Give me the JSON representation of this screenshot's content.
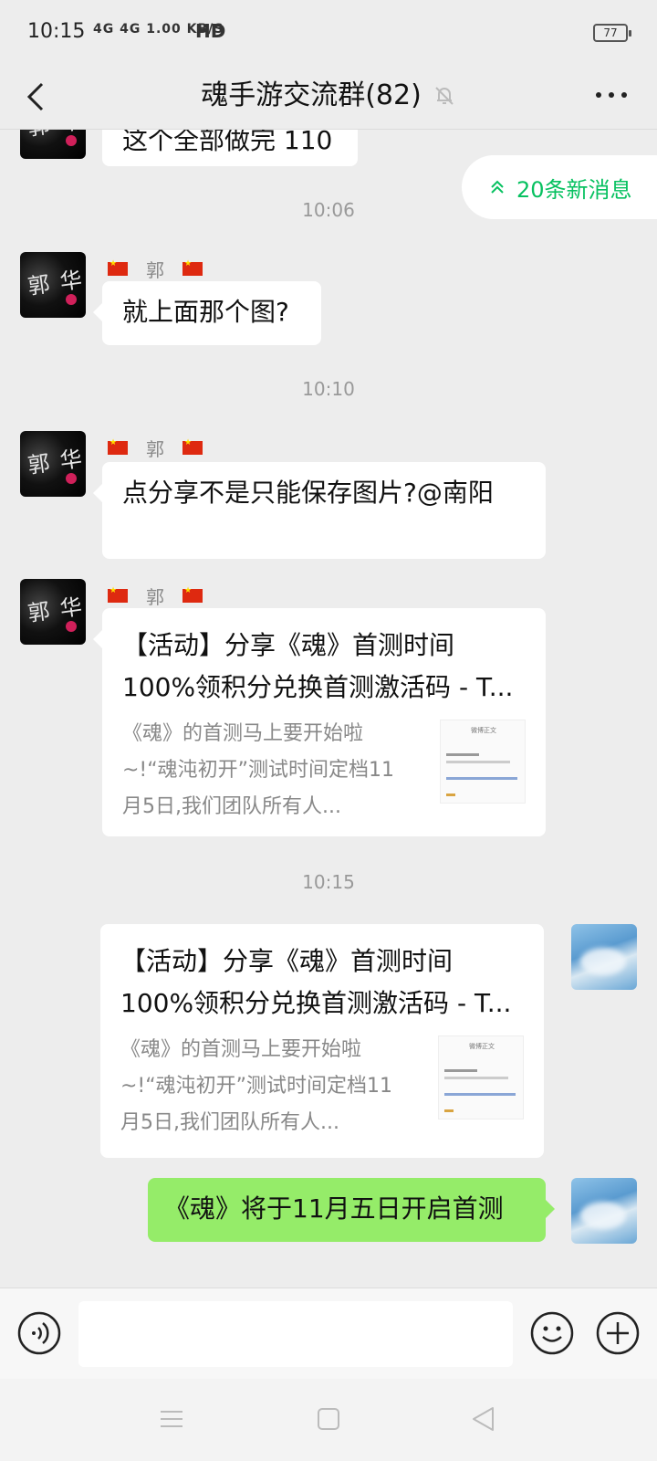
{
  "status_bar": {
    "time": "10:15",
    "signal": "4G 4G 1.00 KB/S",
    "hd": "HD",
    "battery": "77"
  },
  "header": {
    "title": "魂手游交流群(82)"
  },
  "new_messages_pill": {
    "label": "20条新消息"
  },
  "messages": [
    {
      "text": "这个全部做完 110"
    },
    {
      "timestamp": "10:06"
    },
    {
      "sender": "郭",
      "text": "就上面那个图?"
    },
    {
      "timestamp": "10:10"
    },
    {
      "sender": "郭",
      "text": "点分享不是只能保存图片?@南阳"
    },
    {
      "sender": "郭",
      "link_title": "【活动】分享《魂》首测时间100%领积分兑换首测激活码 - T...",
      "link_desc": "《魂》的首测马上要开始啦~!“魂沌初开”测试时间定档11月5日,我们团队所有人...",
      "thumb_header": "微博正文"
    },
    {
      "timestamp": "10:15"
    },
    {
      "own": true,
      "link_title": "【活动】分享《魂》首测时间100%领积分兑换首测激活码 - T...",
      "link_desc": "《魂》的首测马上要开始啦~!“魂沌初开”测试时间定档11月5日,我们团队所有人...",
      "thumb_header": "微博正文"
    },
    {
      "own": true,
      "text": "《魂》将于11月五日开启首测"
    }
  ],
  "input": {
    "value": "",
    "placeholder": ""
  },
  "icons": {
    "back": "back-arrow-icon",
    "mute": "mute-bell-icon",
    "more": "more-dots-icon",
    "voice": "voice-icon",
    "emoji": "emoji-icon",
    "plus": "plus-icon",
    "nav_menu": "menu-icon",
    "nav_home": "home-icon",
    "nav_back": "nav-back-icon"
  },
  "colors": {
    "accent_green": "#07c160",
    "own_bubble": "#95ec69",
    "background": "#ededed"
  }
}
